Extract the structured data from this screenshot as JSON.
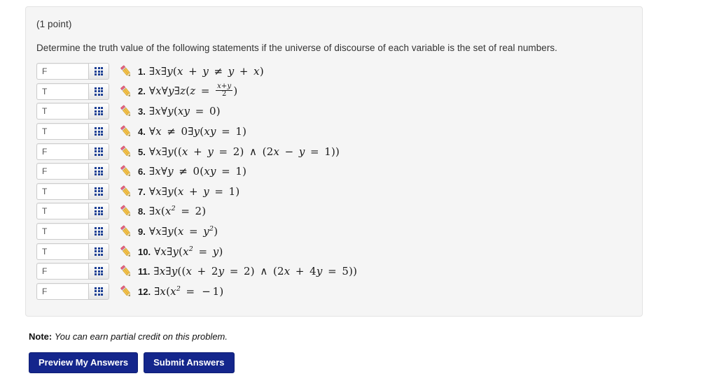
{
  "panel": {
    "points": "(1 point)",
    "prompt": "Determine the truth value of the following statements if the universe of discourse of each variable is the set of real numbers."
  },
  "icons": {
    "grid": "grid-icon",
    "pencil": "pencil-icon"
  },
  "answer_input_placeholder": "",
  "rows": [
    {
      "num": "1.",
      "value": "F",
      "statement": "∃x∃y(x + y ≠ y + x)"
    },
    {
      "num": "2.",
      "value": "T",
      "statement": "∀x∀y∃z(z = (x+y)/2)"
    },
    {
      "num": "3.",
      "value": "T",
      "statement": "∃x∀y(xy = 0)"
    },
    {
      "num": "4.",
      "value": "T",
      "statement": "∀x ≠ 0∃y(xy = 1)"
    },
    {
      "num": "5.",
      "value": "F",
      "statement": "∀x∃y((x + y = 2) ∧ (2x − y = 1))"
    },
    {
      "num": "6.",
      "value": "F",
      "statement": "∃x∀y ≠ 0(xy = 1)"
    },
    {
      "num": "7.",
      "value": "T",
      "statement": "∀x∃y(x + y = 1)"
    },
    {
      "num": "8.",
      "value": "T",
      "statement": "∃x(x² = 2)"
    },
    {
      "num": "9.",
      "value": "T",
      "statement": "∀x∃y(x = y²)"
    },
    {
      "num": "10.",
      "value": "T",
      "statement": "∀x∃y(x² = y)"
    },
    {
      "num": "11.",
      "value": "F",
      "statement": "∃x∃y((x + 2y = 2) ∧ (2x + 4y = 5))"
    },
    {
      "num": "12.",
      "value": "F",
      "statement": "∃x(x² = −1)"
    }
  ],
  "note": {
    "label": "Note:",
    "text": "You can earn partial credit on this problem."
  },
  "buttons": {
    "preview": "Preview My Answers",
    "submit": "Submit Answers"
  },
  "colors": {
    "panel_bg": "#f5f5f5",
    "button_blue": "#14268c",
    "grid_icon_navy": "#1c3f94"
  }
}
